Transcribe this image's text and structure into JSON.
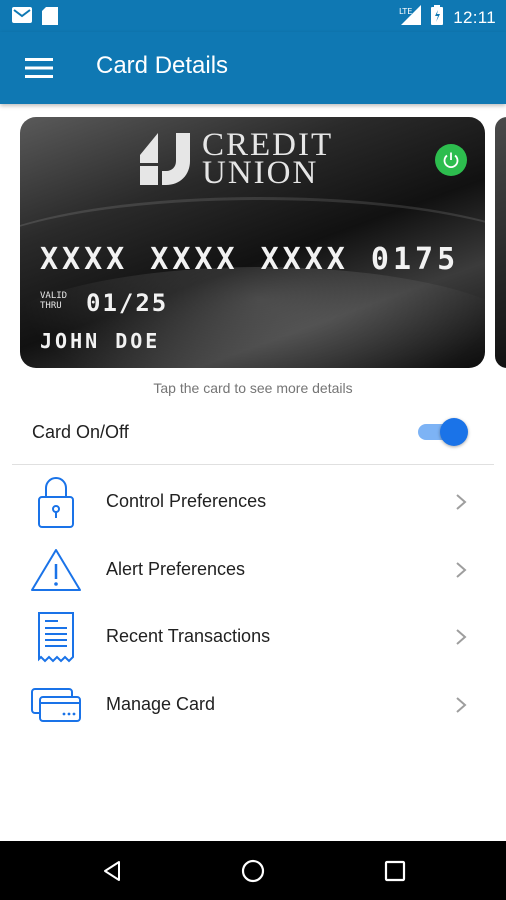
{
  "status_bar": {
    "time": "12:11",
    "icons": [
      "gmail-icon",
      "sd-card-icon",
      "signal-icon",
      "battery-icon"
    ]
  },
  "app_bar": {
    "title": "Card Details",
    "menu_icon": "hamburger-menu-icon",
    "background": "#0f78b3"
  },
  "card": {
    "brand_line1": "CREDIT",
    "brand_line2": "UNION",
    "number": "XXXX XXXX XXXX 0175",
    "valid_line1": "VALID",
    "valid_line2": "THRU",
    "expiry": "01/25",
    "holder": "JOHN DOE",
    "power_color": "#2dbd4e"
  },
  "hint": "Tap the card to see more details",
  "card_toggle": {
    "label": "Card On/Off",
    "on": true,
    "accent": "#1a73e8"
  },
  "menu": {
    "items": [
      {
        "label": "Control Preferences",
        "icon": "lock-icon"
      },
      {
        "label": "Alert Preferences",
        "icon": "warning-icon"
      },
      {
        "label": "Recent Transactions",
        "icon": "receipt-icon"
      },
      {
        "label": "Manage Card",
        "icon": "cards-icon"
      }
    ]
  },
  "nav_bar": {
    "buttons": [
      "back-icon",
      "home-icon",
      "recents-icon"
    ]
  }
}
